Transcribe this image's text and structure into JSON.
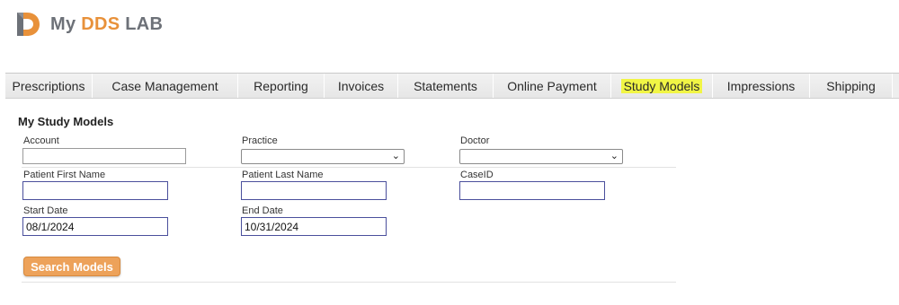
{
  "brand": {
    "name_part1": "My ",
    "name_part2": "DDS",
    "name_part3": " LAB",
    "color_gray": "#6d7178",
    "color_orange": "#e8913a"
  },
  "nav": {
    "tabs": [
      {
        "label": "Prescriptions",
        "active": false
      },
      {
        "label": "Case Management",
        "active": false
      },
      {
        "label": "Reporting",
        "active": false
      },
      {
        "label": "Invoices",
        "active": false
      },
      {
        "label": "Statements",
        "active": false
      },
      {
        "label": "Online Payment",
        "active": false
      },
      {
        "label": "Study Models",
        "active": true
      },
      {
        "label": "Impressions",
        "active": false
      },
      {
        "label": "Shipping",
        "active": false
      }
    ],
    "highlight_color": "#f1f545"
  },
  "form": {
    "title": "My Study Models",
    "account_label": "Account",
    "account_value": "",
    "practice_label": "Practice",
    "practice_value": "",
    "doctor_label": "Doctor",
    "doctor_value": "",
    "first_name_label": "Patient First Name",
    "first_name_value": "",
    "last_name_label": "Patient Last Name",
    "last_name_value": "",
    "caseid_label": "CaseID",
    "caseid_value": "",
    "start_date_label": "Start Date",
    "start_date_value": "08/1/2024",
    "end_date_label": "End Date",
    "end_date_value": "10/31/2024",
    "search_button_label": "Search Models",
    "button_color": "#eda25a"
  }
}
